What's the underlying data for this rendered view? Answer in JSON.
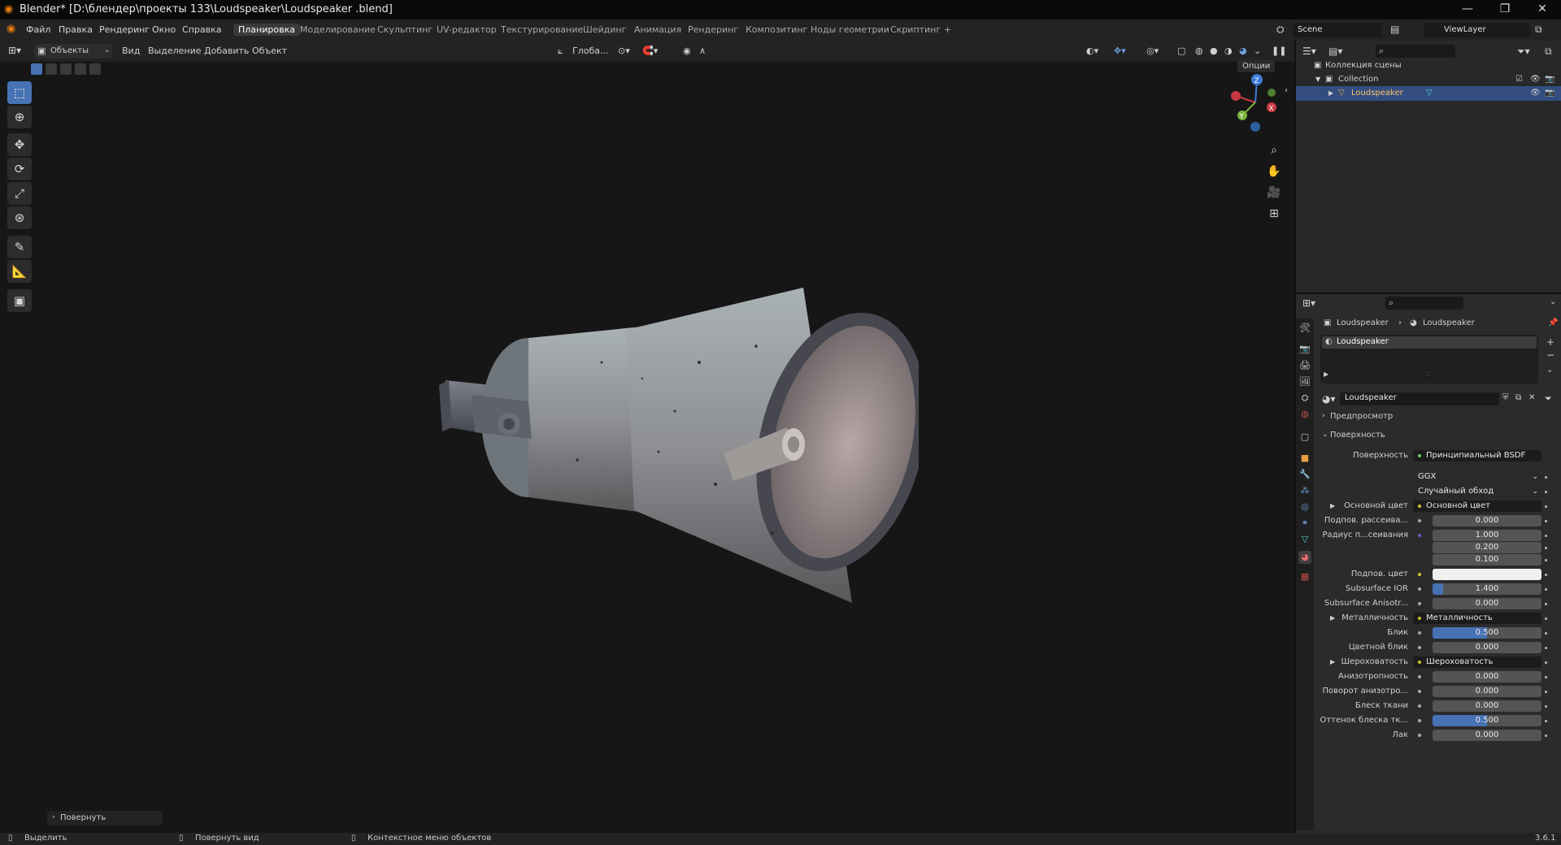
{
  "window": {
    "title": "Blender* [D:\\блендер\\проекты 133\\Loudspeaker\\Loudspeaker .blend]",
    "controls": [
      "—",
      "❐",
      "✕"
    ]
  },
  "menu": [
    "Файл",
    "Правка",
    "Рендеринг",
    "Окно",
    "Справка"
  ],
  "workspaces": [
    "Планировка",
    "Моделирование",
    "Скульптинг",
    "UV-редактор",
    "Текстурирование",
    "Шейдинг",
    "Анимация",
    "Рендеринг",
    "Композитинг",
    "Ноды геометрии",
    "Скриптинг"
  ],
  "workspace_add": "+",
  "scene": {
    "name": "Scene",
    "view_layer": "ViewLayer"
  },
  "viewport_header": {
    "mode": "Объекты",
    "menus": [
      "Вид",
      "Выделение",
      "Добавить",
      "Объект"
    ],
    "transform_orientation": "Глоба...",
    "options": "Опции"
  },
  "gizmo": {
    "z": "Z",
    "y": "Y",
    "x": "X"
  },
  "last_operator": "Повернуть",
  "outliner": {
    "scene_collection": "Коллекция сцены",
    "collection": "Collection",
    "object": "Loudspeaker"
  },
  "properties": {
    "breadcrumb_object": "Loudspeaker",
    "breadcrumb_material": "Loudspeaker",
    "material_slot": "Loudspeaker",
    "material_name": "Loudspeaker",
    "panel_preview": "Предпросмотр",
    "panel_surface": "Поверхность",
    "surface_label": "Поверхность",
    "surface_value": "Принципиальный BSDF",
    "distribution": "GGX",
    "subsurface_method": "Случайный обход",
    "rows": [
      {
        "label": "Основной цвет",
        "value": "Основной цвет",
        "kind": "link",
        "expand": true
      },
      {
        "label": "Подпов. рассеива...",
        "value": "0.000",
        "kind": "num",
        "fill": 0
      },
      {
        "label": "Радиус п...сеивания",
        "value": "1.000",
        "kind": "num",
        "fill": 0
      },
      {
        "label": "",
        "value": "0.200",
        "kind": "num",
        "fill": 0
      },
      {
        "label": "",
        "value": "0.100",
        "kind": "num",
        "fill": 0
      },
      {
        "label": "Подпов. цвет",
        "value": "",
        "kind": "color"
      },
      {
        "label": "Subsurface IOR",
        "value": "1.400",
        "kind": "num",
        "fill": 0.1
      },
      {
        "label": "Subsurface Anisotr...",
        "value": "0.000",
        "kind": "num",
        "fill": 0
      },
      {
        "label": "Металличность",
        "value": "Металличность",
        "kind": "link",
        "expand": true
      },
      {
        "label": "Блик",
        "value": "0.500",
        "kind": "num",
        "fill": 0.5
      },
      {
        "label": "Цветной блик",
        "value": "0.000",
        "kind": "num",
        "fill": 0
      },
      {
        "label": "Шероховатость",
        "value": "Шероховатость",
        "kind": "link",
        "expand": true
      },
      {
        "label": "Анизотропность",
        "value": "0.000",
        "kind": "num",
        "fill": 0
      },
      {
        "label": "Поворот анизотро...",
        "value": "0.000",
        "kind": "num",
        "fill": 0
      },
      {
        "label": "Блеск ткани",
        "value": "0.000",
        "kind": "num",
        "fill": 0
      },
      {
        "label": "Оттенок блеска тк...",
        "value": "0.500",
        "kind": "num",
        "fill": 0.5
      },
      {
        "label": "Лак",
        "value": "0.000",
        "kind": "num",
        "fill": 0
      }
    ]
  },
  "status_bar": {
    "select": "Выделить",
    "rotate_view": "Повернуть вид",
    "context_menu": "Контекстное меню объектов",
    "version": "3.6.1"
  },
  "colors": {
    "accent": "#4772b3",
    "selected_row": "#334d80"
  }
}
